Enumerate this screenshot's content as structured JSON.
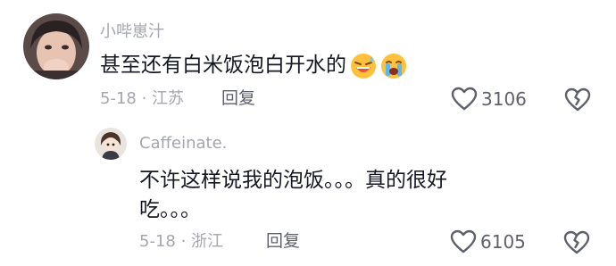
{
  "comments": [
    {
      "username": "小哔崽汁",
      "text": "甚至还有白米饭泡白开水的",
      "emojis": [
        "grinning-sweat-emoji",
        "crying-emoji"
      ],
      "date_location": "5-18 · 江苏",
      "reply_label": "回复",
      "like_count": "3106"
    },
    {
      "username": "Caffeinate.",
      "text_line1": "不许这样说我的泡饭。。。真的很好",
      "text_line2": "吃。。。",
      "date_location": "5-18 · 浙江",
      "reply_label": "回复",
      "like_count": "6105"
    }
  ],
  "icons": {
    "like": "heart-outline-icon",
    "dislike": "broken-heart-icon"
  },
  "colors": {
    "username": "#a3a6ad",
    "body_text": "#161823",
    "action_text": "#5e606b"
  }
}
